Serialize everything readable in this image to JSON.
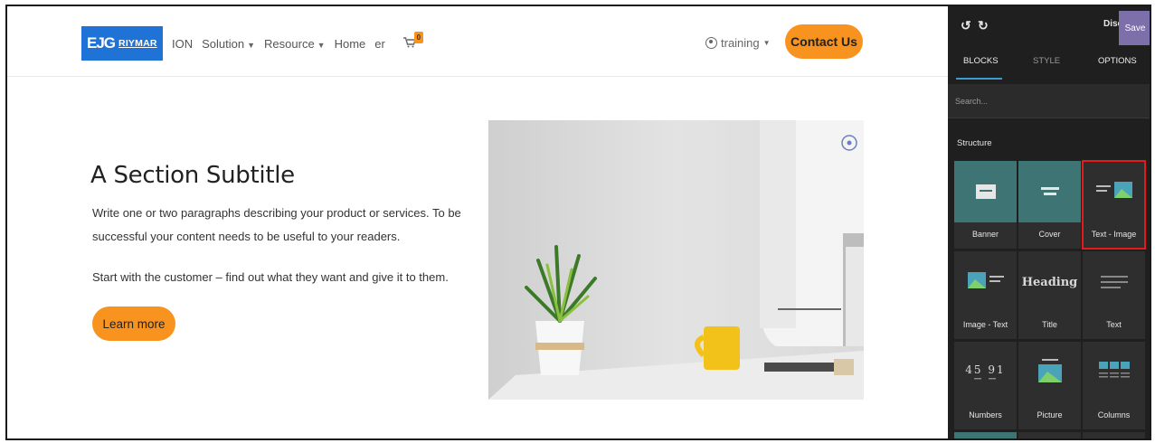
{
  "site": {
    "logo": {
      "mark": "EJG",
      "text": "RIYMAR"
    },
    "nav": [
      {
        "label": "ION",
        "dropdown": false
      },
      {
        "label": "Solution",
        "dropdown": true
      },
      {
        "label": "Resource",
        "dropdown": true
      },
      {
        "label": "Home",
        "dropdown": false
      },
      {
        "label": "er",
        "dropdown": false
      }
    ],
    "cart_count": "0",
    "user": "training",
    "contact_label": "Contact Us",
    "section_title": "A Section Subtitle",
    "paragraph1": "Write one or two paragraphs describing your product or services. To be successful your content needs to be useful to your readers.",
    "paragraph2": "Start with the customer – find out what they want and give it to them.",
    "learn_more_label": "Learn more"
  },
  "editor": {
    "undo_icon": "undo-icon",
    "redo_icon": "redo-icon",
    "discard_label": "Discard",
    "save_label": "Save",
    "tabs": [
      "BLOCKS",
      "STYLE",
      "OPTIONS"
    ],
    "active_tab": "BLOCKS",
    "search_placeholder": "Search...",
    "structure_label": "Structure",
    "blocks": [
      {
        "label": "Banner",
        "selected": false
      },
      {
        "label": "Cover",
        "selected": false
      },
      {
        "label": "Text - Image",
        "selected": true
      },
      {
        "label": "Image - Text",
        "selected": false
      },
      {
        "label": "Title",
        "selected": false
      },
      {
        "label": "Text",
        "selected": false
      },
      {
        "label": "Numbers",
        "selected": false
      },
      {
        "label": "Picture",
        "selected": false
      },
      {
        "label": "Columns",
        "selected": false
      }
    ],
    "title_preview": "Heading",
    "numbers_preview": [
      "45",
      "91"
    ]
  },
  "colors": {
    "accent_orange": "#f7931e",
    "logo_blue": "#1f73d6",
    "editor_bg": "#1f1f1f",
    "save_purple": "#7c6faa",
    "selection_red": "#e21b1b",
    "tile_teal": "#3f7474"
  }
}
